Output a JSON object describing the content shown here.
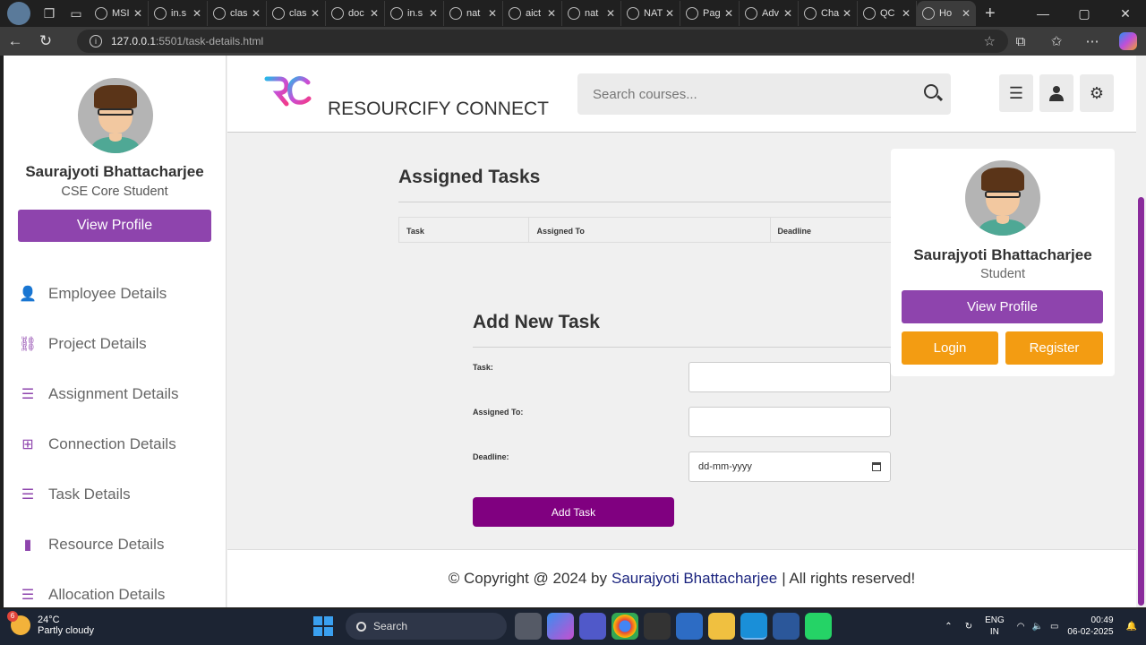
{
  "browser": {
    "tabs": [
      {
        "label": "MSI"
      },
      {
        "label": "in.s"
      },
      {
        "label": "clas"
      },
      {
        "label": "clas"
      },
      {
        "label": "doc"
      },
      {
        "label": "in.s"
      },
      {
        "label": "nat"
      },
      {
        "label": "aict"
      },
      {
        "label": "nat"
      },
      {
        "label": "NAT"
      },
      {
        "label": "Pag"
      },
      {
        "label": "Adv"
      },
      {
        "label": "Cha"
      },
      {
        "label": "QC"
      },
      {
        "label": "Ho"
      }
    ],
    "url_host": "127.0.0.1",
    "url_path": ":5501/task-details.html"
  },
  "sidebar": {
    "user_name": "Saurajyoti Bhattacharjee",
    "user_role": "CSE Core Student",
    "view_profile_label": "View Profile",
    "items": [
      {
        "label": "Employee Details",
        "icon": "person-icon"
      },
      {
        "label": "Project Details",
        "icon": "project-diagram-icon"
      },
      {
        "label": "Assignment Details",
        "icon": "task-list-icon"
      },
      {
        "label": "Connection Details",
        "icon": "network-icon"
      },
      {
        "label": "Task Details",
        "icon": "task-list-icon"
      },
      {
        "label": "Resource Details",
        "icon": "book-icon"
      },
      {
        "label": "Allocation Details",
        "icon": "list-icon"
      }
    ]
  },
  "header": {
    "brand": "RESOURCIFY CONNECT",
    "search_placeholder": "Search courses..."
  },
  "assigned_tasks": {
    "title": "Assigned Tasks",
    "columns": [
      "Task",
      "Assigned To",
      "Deadline"
    ]
  },
  "add_task": {
    "title": "Add New Task",
    "task_label": "Task:",
    "assigned_to_label": "Assigned To:",
    "deadline_label": "Deadline:",
    "deadline_placeholder": "dd-mm-yyyy",
    "submit_label": "Add Task"
  },
  "profile_popup": {
    "user_name": "Saurajyoti Bhattacharjee",
    "user_role": "Student",
    "view_profile_label": "View Profile",
    "login_label": "Login",
    "register_label": "Register"
  },
  "footer": {
    "prefix": "© Copyright @ 2024 by",
    "author": "Saurajyoti Bhattacharjee",
    "suffix": "| All rights reserved!"
  },
  "taskbar": {
    "temperature": "24°C",
    "weather": "Partly cloudy",
    "weather_badge": "6",
    "search_label": "Search",
    "lang_top": "ENG",
    "lang_bottom": "IN",
    "time": "00:49",
    "date": "06-02-2025"
  },
  "colors": {
    "accent": "#8e44ad",
    "submit": "#800080",
    "orange": "#f39c12",
    "footer_author": "#1a237e"
  }
}
